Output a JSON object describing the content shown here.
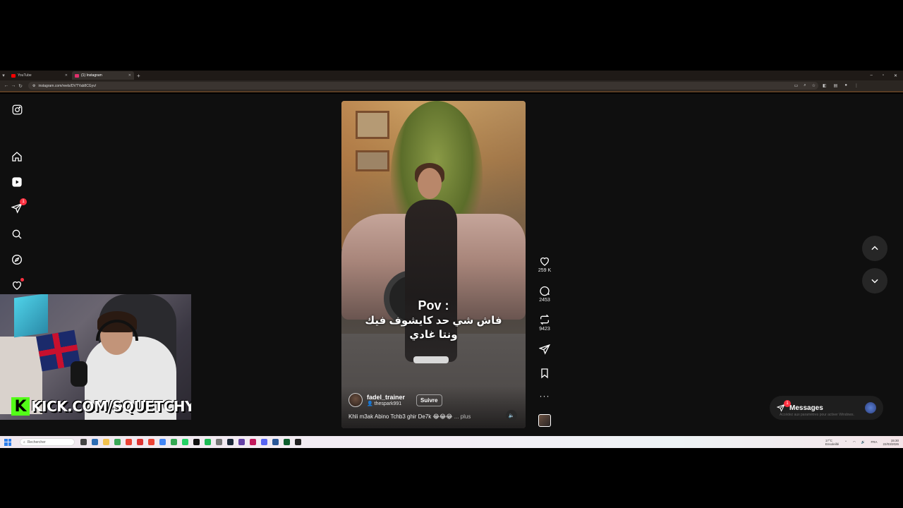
{
  "browser": {
    "tabs": [
      {
        "label": "YouTube",
        "color": "#ff0000",
        "active": false
      },
      {
        "label": "(1) Instagram",
        "color": "#e1306c",
        "active": true
      }
    ],
    "new_tab": "+",
    "url": "instagram.com/reels/DVTYab8CGyv/",
    "window_controls": [
      "–",
      "▫",
      "✕"
    ]
  },
  "sidebar": {
    "items": [
      {
        "name": "instagram-icon"
      },
      {
        "name": "home-icon"
      },
      {
        "name": "reels-icon"
      },
      {
        "name": "direct-icon",
        "badge": "1"
      },
      {
        "name": "search-icon"
      },
      {
        "name": "explore-icon"
      },
      {
        "name": "notifications-icon",
        "dot": true
      }
    ]
  },
  "reel": {
    "caption_pov": "Pov :",
    "caption_arabic_line1": "فاش شي حد كايشوف فيك",
    "caption_arabic_line2": "ونتا غادي",
    "author": "fadel_trainer",
    "audio_user": "thespark991",
    "follow": "Suivre",
    "description": "Khli m3ak Abino Tchb3 ghir De7k 😂😂😂",
    "more": "... plus"
  },
  "actions": {
    "likes": "259 K",
    "comments": "2453",
    "reposts": "9423"
  },
  "messages": {
    "label": "Messages",
    "badge": "1",
    "watermark": "Accédez aux paramètres pour activer Windows."
  },
  "webcam": {
    "kick_letter": "K",
    "kick_text": "KICK.COM/SQUETCHY"
  },
  "taskbar": {
    "search_placeholder": "Rechercher",
    "weather_temp": "17°C",
    "weather_desc": "Ensoleillé",
    "lang": "FRA",
    "time": "15:30",
    "date": "22/03/2026"
  },
  "colors": {
    "accent_red": "#ff3040",
    "kick_green": "#53fc18",
    "page_bg": "#0f0f0f"
  }
}
